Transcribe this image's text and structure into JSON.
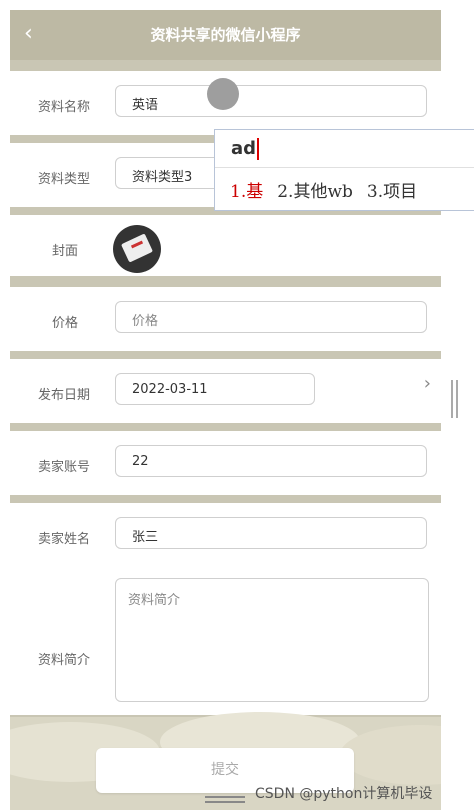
{
  "header": {
    "back_icon": "chevron-left-icon",
    "back_glyph": "‹",
    "title": "资料共享的微信小程序"
  },
  "form": {
    "name": {
      "label": "资料名称",
      "value": "英语"
    },
    "type": {
      "label": "资料类型",
      "value": "资料类型3"
    },
    "cover": {
      "label": "封面"
    },
    "price": {
      "label": "价格",
      "placeholder": "价格"
    },
    "date": {
      "label": "发布日期",
      "value": "2022-03-11",
      "chevron_glyph": "›"
    },
    "seller_account": {
      "label": "卖家账号",
      "value": "22"
    },
    "seller_name": {
      "label": "卖家姓名",
      "value": "张三"
    },
    "intro": {
      "label": "资料简介",
      "placeholder": "资料简介"
    }
  },
  "submit": {
    "label": "提交"
  },
  "ime": {
    "composition": "ad",
    "candidates": [
      "1.基",
      "2.其他wb",
      "3.项目"
    ]
  },
  "watermark": "CSDN @python计算机毕设",
  "colors": {
    "header": "#bdb9a4",
    "background": "#c9c6b4",
    "ime_highlight": "#cc0000"
  }
}
